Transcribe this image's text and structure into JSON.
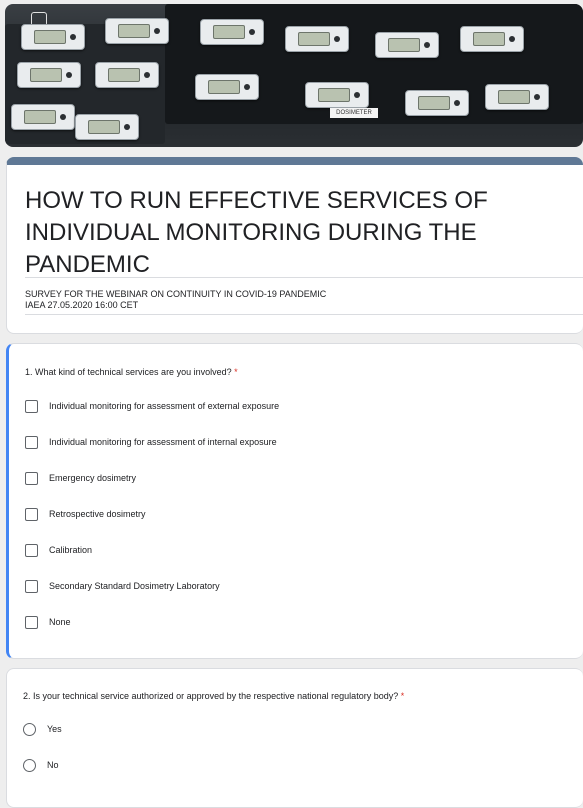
{
  "banner": {
    "device_label": "DOSIMETER",
    "corner_icon": "square-icon"
  },
  "form": {
    "title": "HOW TO RUN EFFECTIVE SERVICES OF INDIVIDUAL MONITORING DURING THE PANDEMIC",
    "description_line1": "SURVEY FOR THE WEBINAR ON CONTINUITY IN COVID-19 PANDEMIC",
    "description_line2": "IAEA 27.05.2020 16:00 CET"
  },
  "questions": [
    {
      "number_title": "1. What kind of technical services are you involved?",
      "required_mark": "*",
      "type": "checkbox",
      "options": [
        "Individual monitoring for assessment of external exposure",
        "Individual monitoring for assessment of internal exposure",
        "Emergency dosimetry",
        "Retrospective dosimetry",
        "Calibration",
        "Secondary Standard Dosimetry Laboratory",
        "None"
      ]
    },
    {
      "number_title": "2. Is your technical service authorized or approved by the respective national regulatory body?",
      "required_mark": "*",
      "type": "radio",
      "options": [
        "Yes",
        "No"
      ]
    }
  ],
  "colors": {
    "title_accent": "#5f7895",
    "active_question_accent": "#4285f4",
    "required": "#d93025"
  }
}
